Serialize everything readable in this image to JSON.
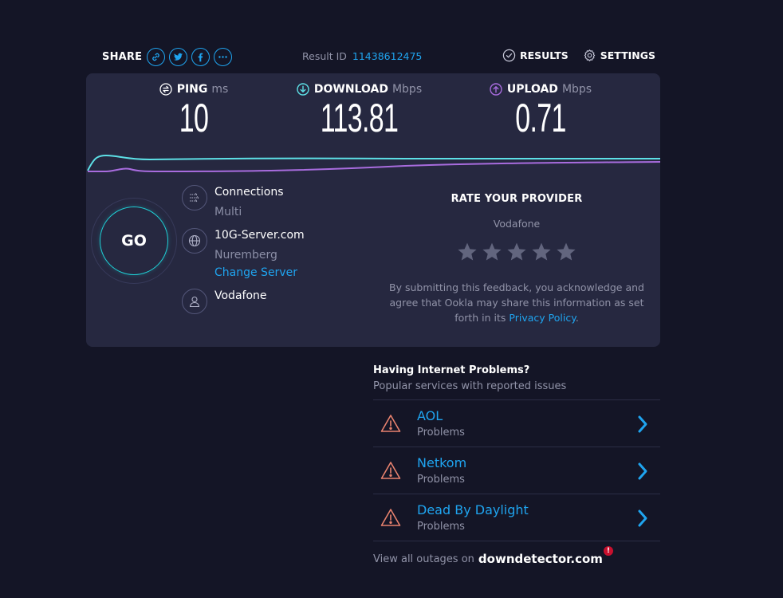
{
  "topbar": {
    "share_label": "SHARE",
    "share_buttons": [
      {
        "icon": "link-icon"
      },
      {
        "icon": "twitter-icon"
      },
      {
        "icon": "facebook-icon"
      },
      {
        "icon": "more-icon"
      }
    ],
    "result_id_label": "Result ID",
    "result_id": "11438612475",
    "results_label": "RESULTS",
    "settings_label": "SETTINGS"
  },
  "metrics": {
    "ping": {
      "label": "PING",
      "unit": "ms",
      "value": "10"
    },
    "download": {
      "label": "DOWNLOAD",
      "unit": "Mbps",
      "value": "113.81"
    },
    "upload": {
      "label": "UPLOAD",
      "unit": "Mbps",
      "value": "0.71"
    }
  },
  "colors": {
    "download": "#5de0e6",
    "upload": "#a86cde",
    "accent": "#1fa4ef",
    "warning": "#e8826e",
    "background": "#141526",
    "card": "#262840"
  },
  "go_label": "GO",
  "info": {
    "connections": {
      "label": "Connections",
      "value": "Multi"
    },
    "server": {
      "name": "10G-Server.com",
      "location": "Nuremberg",
      "change_label": "Change Server"
    },
    "provider": {
      "name": "Vodafone"
    }
  },
  "rate": {
    "title": "RATE YOUR PROVIDER",
    "provider": "Vodafone",
    "stars_total": 5,
    "stars_selected": 0,
    "note_before": "By submitting this feedback, you acknowledge and agree that Ookla may share this information as set forth in its ",
    "privacy_label": "Privacy Policy",
    "note_after": "."
  },
  "problems": {
    "title": "Having Internet Problems?",
    "subtitle": "Popular services with reported issues",
    "items": [
      {
        "name": "AOL",
        "status": "Problems"
      },
      {
        "name": "Netkom",
        "status": "Problems"
      },
      {
        "name": "Dead By Daylight",
        "status": "Problems"
      }
    ],
    "footer_text": "View all outages on",
    "footer_brand": "downdetector.com",
    "footer_badge": "!"
  }
}
